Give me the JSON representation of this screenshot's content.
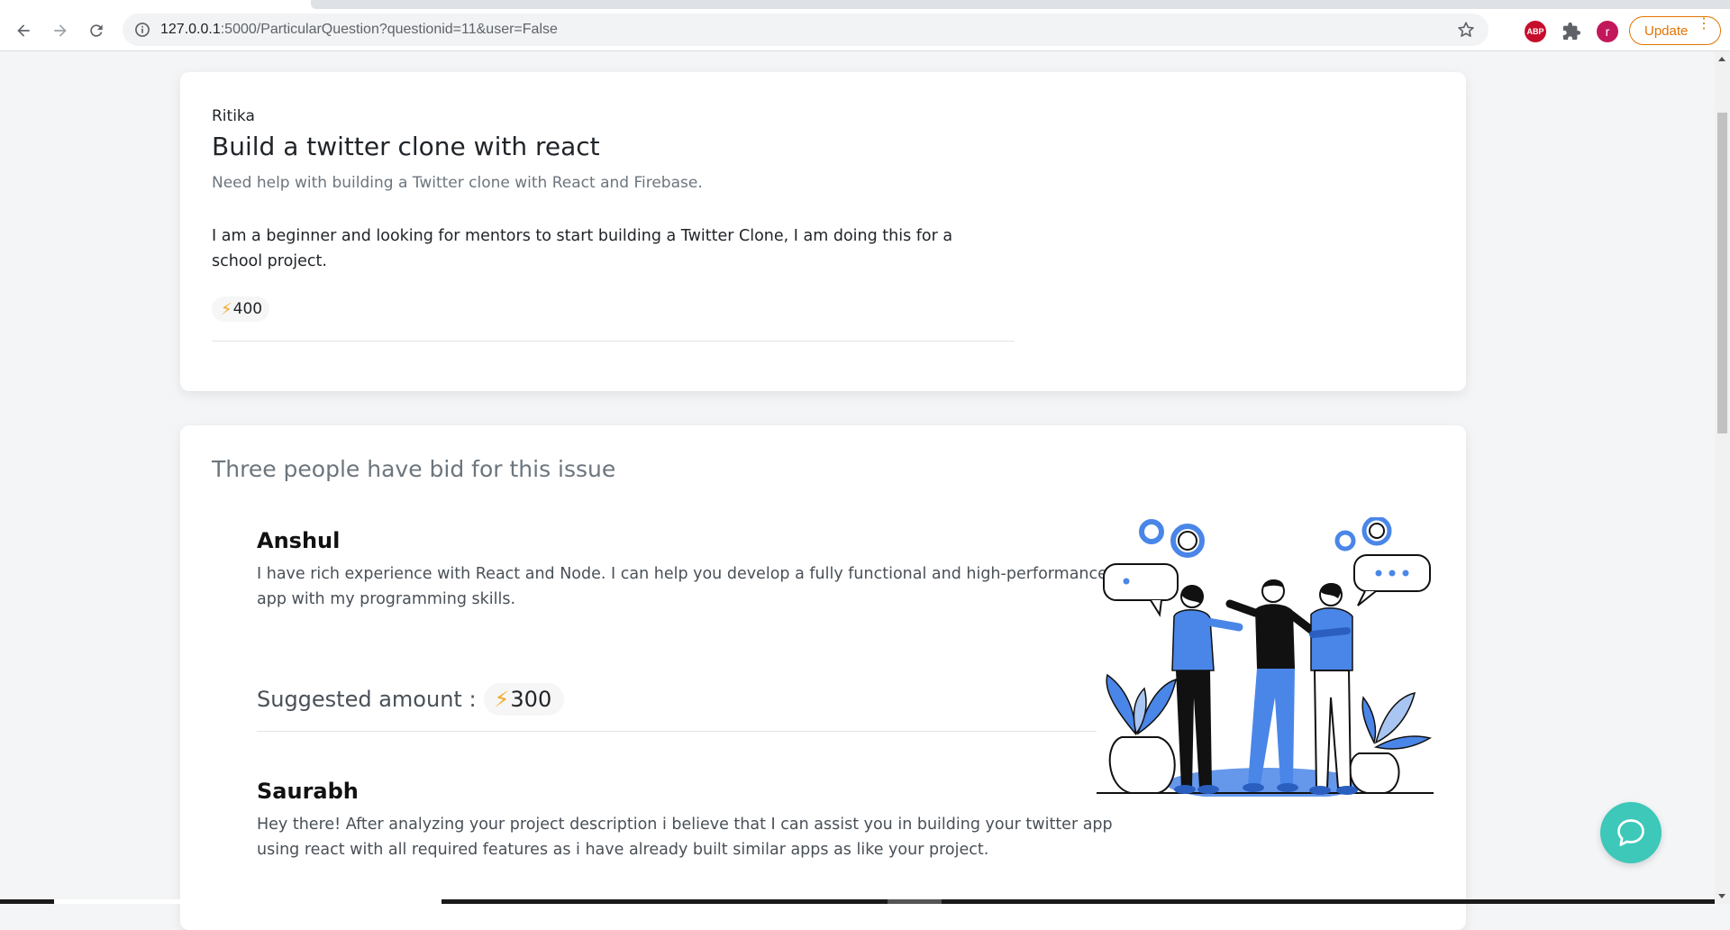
{
  "browser": {
    "url_host": "127.0.0.1",
    "url_rest": ":5000/ParticularQuestion?questionid=11&user=False",
    "extensions": {
      "abp_label": "ABP",
      "avatar_letter": "r"
    },
    "update_label": "Update",
    "update_menu": "⋮"
  },
  "question": {
    "author": "Ritika",
    "title": "Build a twitter clone with react",
    "subtitle": "Need help with building a Twitter clone with React and Firebase.",
    "description": "I am a beginner and looking for mentors to start building a Twitter Clone, I am doing this for a school project.",
    "bolt": "⚡",
    "bounty": "400"
  },
  "bids": {
    "heading": "Three people have bid for this issue",
    "items": [
      {
        "name": "Anshul",
        "text": "I have rich experience with React and Node. I can help you develop a fully functional and high-performance app with my programming skills.",
        "suggested_label": "Suggested amount :",
        "amount": "300"
      },
      {
        "name": "Saurabh",
        "text": "Hey there! After analyzing your project description i believe that I can assist you in building your twitter app using react with all required features as i have already built similar apps as like your project."
      }
    ]
  },
  "colors": {
    "accent_blue": "#4a86e8",
    "bolt": "#f5a623",
    "chat_fab": "#3dc8b9",
    "update_orange": "#e37400"
  },
  "icons": [
    "back-arrow-icon",
    "forward-arrow-icon",
    "reload-icon",
    "info-icon",
    "star-icon",
    "puzzle-icon",
    "chat-icon",
    "lightning-bolt-icon"
  ]
}
